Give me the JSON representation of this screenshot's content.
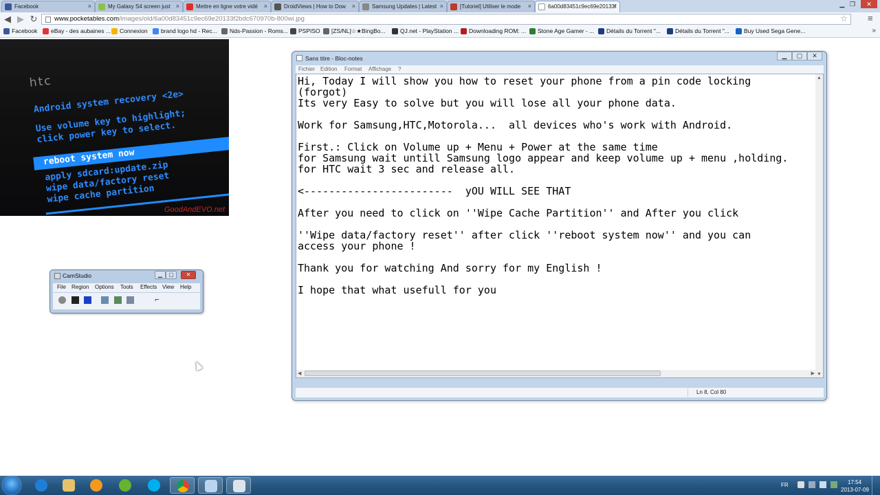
{
  "browser": {
    "tabs": [
      {
        "label": "Facebook",
        "favicon_color": "#3b5998",
        "active": false
      },
      {
        "label": "My Galaxy S4 screen just",
        "favicon_color": "#8bc34a",
        "active": false
      },
      {
        "label": "Mettre en ligne votre vidé",
        "favicon_color": "#e52d27",
        "active": false
      },
      {
        "label": "DroidViews | How to Dow",
        "favicon_color": "#555555",
        "active": false
      },
      {
        "label": "Samsung Updates | Latest",
        "favicon_color": "#888888",
        "active": false
      },
      {
        "label": "[Tutoriel] Utiliser le mode",
        "favicon_color": "#c0392b",
        "active": false
      },
      {
        "label": "6a00d83451c9ec69e20133f",
        "favicon_color": "#ffffff",
        "active": true
      }
    ],
    "url_host": "www.pocketables.com",
    "url_path": "/images/old/6a00d83451c9ec69e20133f2bdc670970b-800wi.jpg",
    "bookmarks": [
      {
        "label": "Facebook",
        "color": "#3b5998"
      },
      {
        "label": "eBay - des aubaines ...",
        "color": "#e53238"
      },
      {
        "label": "Connexion",
        "color": "#f4b400"
      },
      {
        "label": "brand logo hd - Rec...",
        "color": "#4285f4"
      },
      {
        "label": "Nds-Passion - Roms...",
        "color": "#666666"
      },
      {
        "label": "PSPISO",
        "color": "#444444"
      },
      {
        "label": "[ZS/NL]☆★BingBo...",
        "color": "#666666"
      },
      {
        "label": "QJ.net - PlayStation ...",
        "color": "#333333"
      },
      {
        "label": "Downloading ROM: ...",
        "color": "#b71c1c"
      },
      {
        "label": "Stone Age Gamer - ...",
        "color": "#2e7d32"
      },
      {
        "label": "Détails du Torrent \"...",
        "color": "#1a3e7a"
      },
      {
        "label": "Détails du Torrent \"...",
        "color": "#1a3e7a"
      },
      {
        "label": "Buy Used Sega Gene...",
        "color": "#1565c0"
      }
    ],
    "more_bookmarks": "»"
  },
  "recovery_image": {
    "brand": "htc",
    "lines": [
      "Android system recovery <2e>",
      "Use volume key to highlight;",
      "click power key to select."
    ],
    "highlighted": "reboot system now",
    "options": [
      "apply sdcard:update.zip",
      "wipe data/factory reset",
      "wipe cache partition"
    ],
    "watermark": "GoodAndEVO.net"
  },
  "camstudio": {
    "title": "CamStudio",
    "menu": [
      "File",
      "Region",
      "Options",
      "Tools",
      "Effects",
      "View",
      "Help"
    ]
  },
  "notepad": {
    "title": "Sans titre - Bloc-notes",
    "menu": [
      "Fichier",
      "Edition",
      "Format",
      "Affichage",
      "?"
    ],
    "content": "Hi, Today I will show you how to reset your phone from a pin code locking\n(forgot)\nIts very Easy to solve but you will lose all your phone data.\n\nWork for Samsung,HTC,Motorola...  all devices who's work with Android.\n\nFirst.: Click on Volume up + Menu + Power at the same time\nfor Samsung wait untill Samsung logo appear and keep volume up + menu ,holding.\nfor HTC wait 3 sec and release all.\n\n<------------------------  yOU WILL SEE THAT\n\nAfter you need to click on ''Wipe Cache Partition'' and After you click\n\n''Wipe data/factory reset'' after click ''reboot system now'' and you can\naccess your phone !\n\nThank you for watching And sorry for my English !\n\nI hope that what usefull for you",
    "status": "Ln 8, Col 80"
  },
  "taskbar": {
    "language": "FR",
    "time": "17:54",
    "date": "2013-07-09"
  },
  "colors": {
    "taskbar": "#255681",
    "window_frame": "#c2d5ea",
    "recovery_text": "#2f8cff",
    "recovery_highlight": "#1e8cff"
  }
}
